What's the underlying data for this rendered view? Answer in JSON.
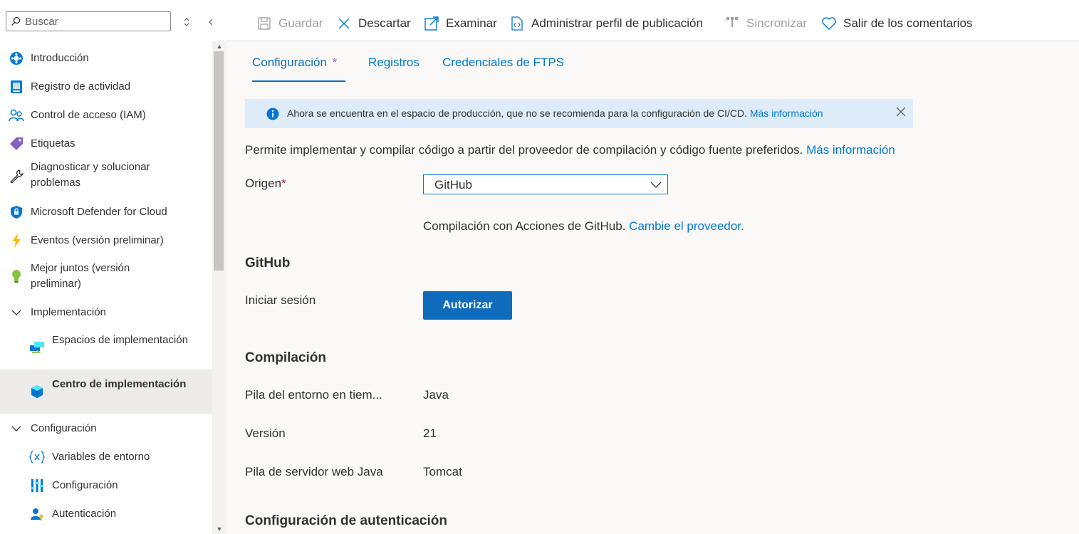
{
  "search": {
    "placeholder": "Buscar"
  },
  "nav": {
    "items": [
      {
        "label": "Introducción",
        "icon": "overview-icon"
      },
      {
        "label": "Registro de actividad",
        "icon": "activity-log-icon"
      },
      {
        "label": "Control de acceso (IAM)",
        "icon": "people-icon"
      },
      {
        "label": "Etiquetas",
        "icon": "tag-icon"
      },
      {
        "label": "Diagnosticar y solucionar problemas",
        "icon": "wrench-icon"
      },
      {
        "label": "Microsoft Defender for Cloud",
        "icon": "shield-icon"
      },
      {
        "label": "Eventos (versión preliminar)",
        "icon": "lightning-icon"
      },
      {
        "label": "Mejor juntos (versión preliminar)",
        "icon": "lightbulb-icon"
      },
      {
        "label": "Implementación",
        "icon": "chevron-down-icon"
      },
      {
        "label": "Espacios de implementación",
        "icon": "deployment-slots-icon"
      },
      {
        "label": "Centro de implementación",
        "icon": "cube-icon",
        "selected": true
      },
      {
        "label": "Configuración",
        "icon": "chevron-down-icon"
      },
      {
        "label": "Variables de entorno",
        "icon": "variable-icon"
      },
      {
        "label": "Configuración",
        "icon": "settings-bars-icon"
      },
      {
        "label": "Autenticación",
        "icon": "user-key-icon"
      }
    ]
  },
  "toolbar": {
    "save": "Guardar",
    "discard": "Descartar",
    "browse": "Examinar",
    "manage_profile": "Administrar perfil de publicación",
    "sync": "Sincronizar",
    "feedback": "Salir de los comentarios"
  },
  "tabs": {
    "settings": "Configuración",
    "settings_marker": "*",
    "logs": "Registros",
    "ftps": "Credenciales de FTPS"
  },
  "banner": {
    "text": "Ahora se encuentra en el espacio de producción, que no se recomienda para la configuración de CI/CD.",
    "link": "Más información"
  },
  "intro": {
    "text": "Permite implementar y compilar código a partir del proveedor de compilación y código fuente preferidos.",
    "link": "Más información"
  },
  "source": {
    "label": "Origen",
    "required_marker": "*",
    "value": "GitHub",
    "build_text": "Compilación con Acciones de GitHub.",
    "build_link": "Cambie el proveedor."
  },
  "github": {
    "title": "GitHub",
    "signin_label": "Iniciar sesión",
    "authorize_button": "Autorizar"
  },
  "build": {
    "title": "Compilación",
    "runtime_label": "Pila del entorno en tiem...",
    "runtime_value": "Java",
    "version_label": "Versión",
    "version_value": "21",
    "webserver_label": "Pila de servidor web Java",
    "webserver_value": "Tomcat"
  },
  "auth": {
    "title": "Configuración de autenticación"
  },
  "colors": {
    "accent": "#0f6cbd",
    "link": "#0078d4",
    "banner_bg": "#deecf9",
    "selected_bg": "#edebe9",
    "required": "#a4262c"
  }
}
